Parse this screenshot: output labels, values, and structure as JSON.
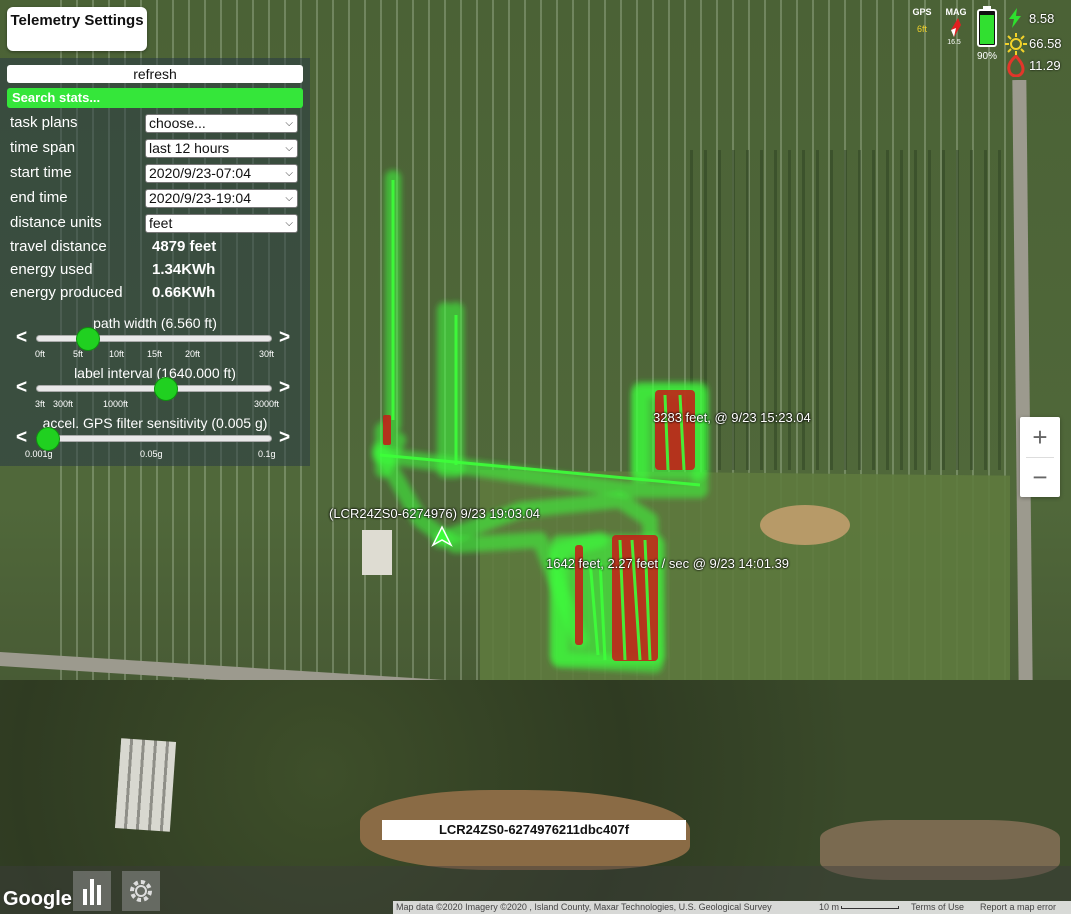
{
  "settings": {
    "toggle_label": "Telemetry Settings",
    "refresh_label": "refresh",
    "search_placeholder": "Search stats...",
    "rows": [
      {
        "label": "task plans",
        "value": "choose..."
      },
      {
        "label": "time span",
        "value": "last 12 hours"
      },
      {
        "label": "start time",
        "value": "2020/9/23-07:04"
      },
      {
        "label": "end time",
        "value": "2020/9/23-19:04"
      },
      {
        "label": "distance units",
        "value": "feet"
      }
    ],
    "stats": [
      {
        "label": "travel distance",
        "value": "4879 feet"
      },
      {
        "label": "energy used",
        "value": "1.34KWh"
      },
      {
        "label": "energy produced",
        "value": "0.66KWh"
      }
    ],
    "sliders": [
      {
        "title": "path width (6.560 ft)",
        "level": 0.22,
        "ticks": [
          "0ft",
          "5ft",
          "10ft",
          "15ft",
          "20ft",
          "30ft"
        ]
      },
      {
        "title": "label interval (1640.000 ft)",
        "level": 0.55,
        "ticks": [
          "3ft",
          "300ft",
          "1000ft",
          "3000ft"
        ]
      },
      {
        "title": "accel. GPS filter sensitivity (0.005 g)",
        "level": 0.05,
        "ticks": [
          "0.001g",
          "0.05g",
          "0.1g"
        ]
      }
    ],
    "prev_arrow": "<",
    "next_arrow": ">"
  },
  "status": {
    "gps_label": "GPS",
    "gps_value": "6ft",
    "mag_label": "MAG",
    "mag_value": "16.5",
    "battery_percent": "90%",
    "battery_level": 0.9,
    "power_in": "8.58",
    "solar": "66.58",
    "consumption": "11.29",
    "icons": [
      "lightning-icon",
      "sun-icon",
      "flame-icon"
    ]
  },
  "map_labels": {
    "label_1": "3283 feet, @ 9/23 15:23.04",
    "label_2": "(LCR24ZS0-6274976) 9/23 19:03.04",
    "label_3": "1642 feet, 2.27 feet / sec @ 9/23 14:01.39"
  },
  "zoom": {
    "in": "+",
    "out": "−"
  },
  "device_id": "LCR24ZS0-6274976211dbc407f",
  "footer": {
    "google": "Google",
    "map_data": "Map data ©2020 Imagery ©2020 , Island County, Maxar Technologies, U.S. Geological Survey",
    "scale": "10 m",
    "terms": "Terms of Use",
    "report": "Report a map error"
  },
  "colors": {
    "track_green": "#3dff3a",
    "track_red": "#d11d1a",
    "search_green": "#35e63a"
  }
}
